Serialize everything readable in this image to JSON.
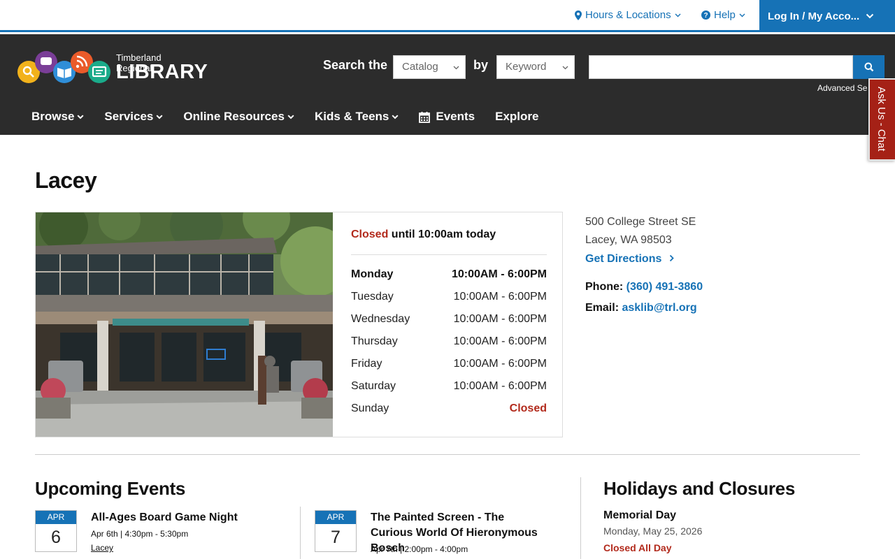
{
  "utility": {
    "hours_locations": "Hours & Locations",
    "help": "Help",
    "login": "Log In / My Acco..."
  },
  "logo": {
    "small": "Timberland Regional",
    "big": "LIBRARY"
  },
  "search": {
    "label": "Search the",
    "catalog": "Catalog",
    "by": "by",
    "keyword": "Keyword",
    "query": "",
    "advanced": "Advanced Search"
  },
  "nav": {
    "browse": "Browse",
    "services": "Services",
    "online_resources": "Online Resources",
    "kids_teens": "Kids & Teens",
    "events": "Events",
    "explore": "Explore"
  },
  "chat": "Ask Us - Chat",
  "branch": {
    "name": "Lacey",
    "status_closed": "Closed",
    "status_rest": " until 10:00am today",
    "hours": [
      {
        "day": "Monday",
        "time": "10:00AM - 6:00PM"
      },
      {
        "day": "Tuesday",
        "time": "10:00AM - 6:00PM"
      },
      {
        "day": "Wednesday",
        "time": "10:00AM - 6:00PM"
      },
      {
        "day": "Thursday",
        "time": "10:00AM - 6:00PM"
      },
      {
        "day": "Friday",
        "time": "10:00AM - 6:00PM"
      },
      {
        "day": "Saturday",
        "time": "10:00AM - 6:00PM"
      },
      {
        "day": "Sunday",
        "time": "Closed"
      }
    ],
    "address_line1": "500 College Street SE",
    "address_line2": "Lacey, WA 98503",
    "directions": "Get Directions",
    "phone_label": "Phone:",
    "phone": "(360) 491-3860",
    "email_label": "Email:",
    "email": "asklib@trl.org"
  },
  "events": {
    "title": "Upcoming Events",
    "items": [
      {
        "month": "APR",
        "day": "6",
        "title": "All-Ages Board Game Night",
        "time": "Apr 6th | 4:30pm - 5:30pm",
        "location": "Lacey"
      },
      {
        "month": "APR",
        "day": "7",
        "title": "The Painted Screen - The Curious World Of Hieronymous Bosch",
        "time": "Apr 7th | 2:00pm - 4:00pm"
      }
    ]
  },
  "holidays": {
    "title": "Holidays and Closures",
    "items": [
      {
        "name": "Memorial Day",
        "date": "Monday, May 25, 2026",
        "status": "Closed All Day"
      }
    ]
  },
  "colors": {
    "brand_blue": "#1672b6",
    "header_dark": "#2c2c2c",
    "closed_red": "#b22a1c"
  }
}
